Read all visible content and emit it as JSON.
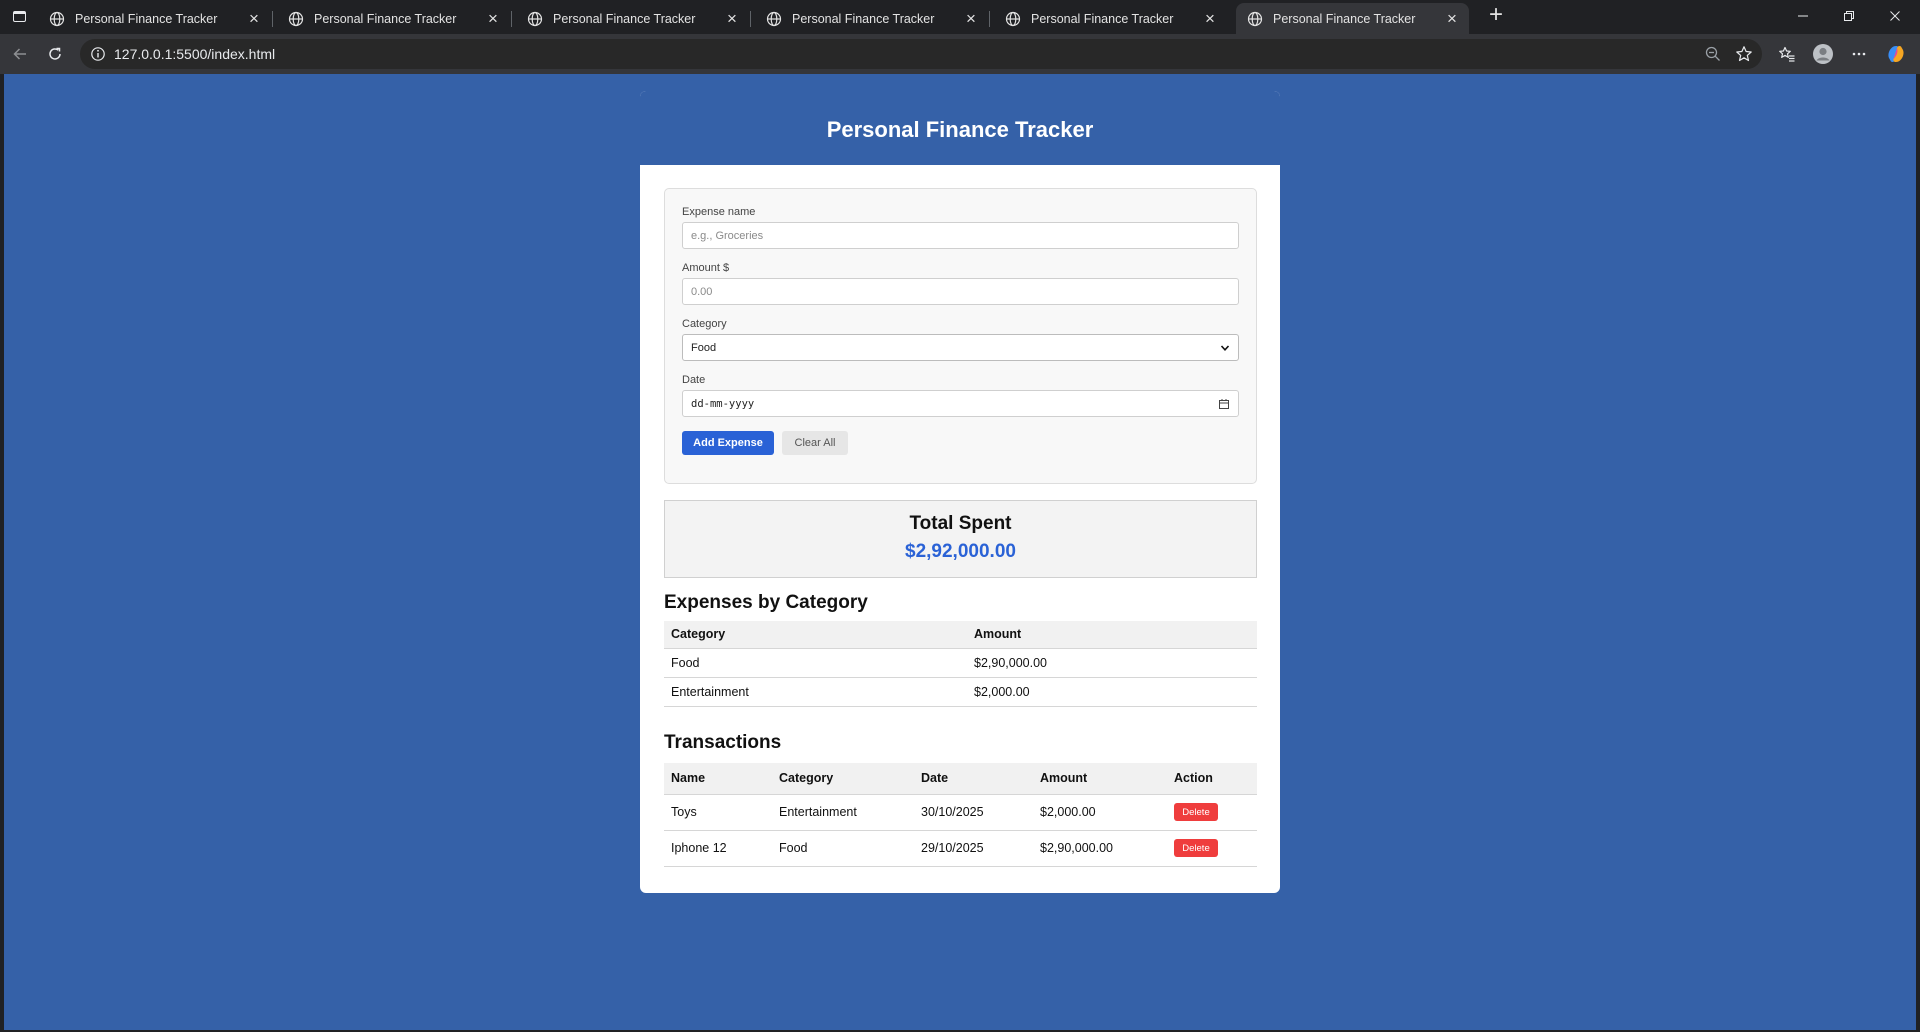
{
  "browser": {
    "tabs": [
      {
        "title": "Personal Finance Tracker",
        "active": false
      },
      {
        "title": "Personal Finance Tracker",
        "active": false
      },
      {
        "title": "Personal Finance Tracker",
        "active": false
      },
      {
        "title": "Personal Finance Tracker",
        "active": false
      },
      {
        "title": "Personal Finance Tracker",
        "active": false
      },
      {
        "title": "Personal Finance Tracker",
        "active": true
      }
    ],
    "url": "127.0.0.1:5500/index.html"
  },
  "page": {
    "title": "Personal Finance Tracker",
    "form": {
      "name_label": "Expense name",
      "name_placeholder": "e.g., Groceries",
      "name_value": "",
      "amount_label": "Amount $",
      "amount_placeholder": "0.00",
      "amount_value": "",
      "category_label": "Category",
      "category_value": "Food",
      "date_label": "Date",
      "date_placeholder": "dd-mm-yyyy",
      "add_button": "Add Expense",
      "clear_button": "Clear All"
    },
    "total": {
      "label": "Total Spent",
      "value": "$2,92,000.00"
    },
    "by_category": {
      "title": "Expenses by Category",
      "headers": [
        "Category",
        "Amount"
      ],
      "rows": [
        [
          "Food",
          "$2,90,000.00"
        ],
        [
          "Entertainment",
          "$2,000.00"
        ]
      ]
    },
    "transactions": {
      "title": "Transactions",
      "headers": [
        "Name",
        "Category",
        "Date",
        "Amount",
        "Action"
      ],
      "delete_label": "Delete",
      "rows": [
        [
          "Toys",
          "Entertainment",
          "30/10/2025",
          "$2,000.00"
        ],
        [
          "Iphone 12",
          "Food",
          "29/10/2025",
          "$2,90,000.00"
        ]
      ]
    }
  },
  "colors": {
    "page_background": "#3561a8",
    "primary_button": "#2a62d6",
    "delete_button": "#ef3d3d",
    "total_value": "#2a62d6"
  }
}
